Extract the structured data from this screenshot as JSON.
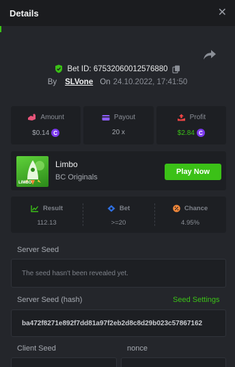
{
  "header": {
    "title": "Details",
    "close_symbol": "✕"
  },
  "bet": {
    "id_label": "Bet ID:",
    "id": "67532060012576880",
    "by_label": "By",
    "user": "SLVone",
    "on_label": "On",
    "time": "24.10.2022, 17:41:50"
  },
  "stats": [
    {
      "label": "Amount",
      "value": "$0.14",
      "coin": true,
      "value_color": "#a6aab1"
    },
    {
      "label": "Payout",
      "value": "20 x",
      "coin": false,
      "value_color": "#a6aab1"
    },
    {
      "label": "Profit",
      "value": "$2.84",
      "coin": true,
      "value_color": "#3bc117"
    }
  ],
  "coin_symbol": "C",
  "game": {
    "name": "Limbo",
    "provider": "BC Originals",
    "play_label": "Play Now",
    "thumb_text": "LIMBO"
  },
  "results": [
    {
      "label": "Result",
      "value": "112.13"
    },
    {
      "label": "Bet",
      "value": ">=20"
    },
    {
      "label": "Chance",
      "value": "4.95%"
    }
  ],
  "server_seed": {
    "label": "Server Seed",
    "value": "The seed hasn't been revealed yet."
  },
  "server_seed_hash": {
    "label": "Server Seed (hash)",
    "settings_label": "Seed Settings",
    "value": "ba472f8271e892f7dd81a97f2eb2d8c8d29b023c57867162"
  },
  "client_seed": {
    "label": "Client Seed"
  },
  "nonce": {
    "label": "nonce"
  },
  "colors": {
    "accent": "#3bc117",
    "coin": "#7c3aed",
    "panel": "#1d1f23",
    "background": "#24262b",
    "amount_icon": "#e8547a",
    "payout_icon": "#8b5cf6",
    "profit_icon": "#ef4444",
    "result_icon": "#3bc117",
    "bet_icon": "#2f6fe0",
    "chance_icon": "#f5893a"
  }
}
